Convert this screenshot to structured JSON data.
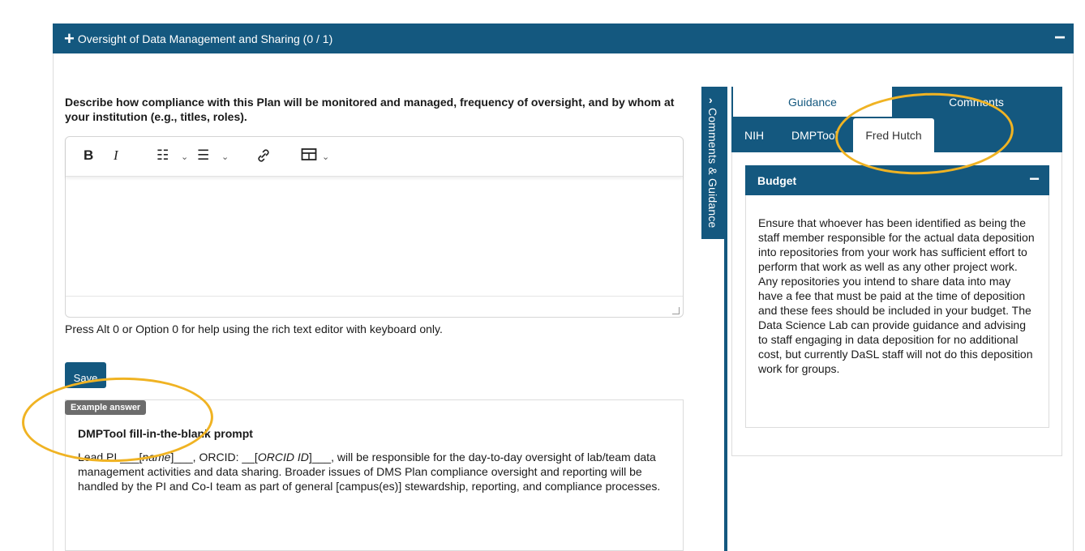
{
  "section": {
    "title": "Oversight of Data Management and Sharing (0 / 1)",
    "expand_glyph": "+",
    "collapse_glyph": "−"
  },
  "question": {
    "text": "Describe how compliance with this Plan will be monitored and managed, frequency of oversight, and by whom at your institution (e.g., titles, roles)."
  },
  "editor": {
    "toolbar": {
      "bold": "B",
      "italic": "I",
      "bullet_list": "☷",
      "numbered_list": "☰",
      "caret": "⌄",
      "link": "🔗",
      "table": "⊞"
    },
    "value": "",
    "help_text": "Press Alt 0 or Option 0 for help using the rich text editor with keyboard only."
  },
  "save_label": "Save",
  "example": {
    "badge": "Example answer",
    "title": "DMPTool fill-in-the-blank prompt",
    "body_prefix": "Lead PI ___[",
    "body_name": "name",
    "body_mid": "]___, ORCID: __[",
    "body_orcid": "ORCID ID",
    "body_rest": "]___, will be responsible for the day-to-day oversight of lab/team data management activities and data sharing. Broader issues of DMS Plan compliance oversight and reporting will be handled by the PI and Co-I team as part of general [campus(es)] stewardship, reporting, and compliance processes."
  },
  "side_panel": {
    "toggle_label": "Comments & Guidance",
    "toggle_glyph": "›",
    "tabs": [
      "Guidance",
      "Comments"
    ],
    "sub_tabs": [
      "NIH",
      "DMPTool",
      "Fred Hutch"
    ],
    "active_tab": "Guidance",
    "active_sub_tab": "Fred Hutch",
    "budget": {
      "title": "Budget",
      "collapse_glyph": "−",
      "text": "Ensure that whoever has been identified as being the staff member responsible for the actual data deposition into repositories from your work has sufficient effort to perform that work as well as any other project work.  Any repositories you intend to share data into may have a fee that must be paid at the time of deposition and these fees should be included in your budget.  The Data Science Lab can provide guidance and advising to staff engaging in data deposition for no additional cost, but currently DaSL staff will not do this deposition work for groups."
    }
  },
  "colors": {
    "brand": "#14587f",
    "highlight_ring": "#f0b323",
    "badge": "#6c6c6c"
  }
}
